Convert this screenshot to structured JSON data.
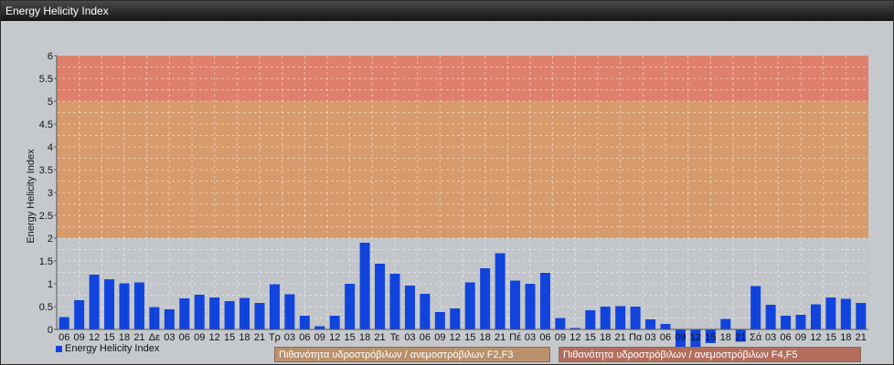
{
  "window": {
    "title": "Energy Helicity Index"
  },
  "legend": {
    "label": "Energy Helicity Index"
  },
  "bands": [
    {
      "label": "Πιθανότητα υδροστρόβιλων / ανεμοστρόβιλων F2,F3",
      "from": 2,
      "to": 5,
      "color": "#d79a6a"
    },
    {
      "label": "Πιθανότητα υδροστρόβιλων / ανεμοστρόβιλων F4,F5",
      "from": 5,
      "to": 6,
      "color": "#de806c"
    }
  ],
  "chart_data": {
    "type": "bar",
    "ylabel": "Energy Helicity Index",
    "ylim": [
      0,
      6
    ],
    "yticks": [
      "0",
      "0.5",
      "1",
      "1.5",
      "2",
      "2.5",
      "3",
      "3.5",
      "4",
      "4.5",
      "5",
      "5.5",
      "6"
    ],
    "grid": true,
    "legend_position": "bottom-left",
    "bar_color": "#1144dd",
    "categories": [
      "06",
      "09",
      "12",
      "15",
      "18",
      "21",
      "Δε",
      "03",
      "06",
      "09",
      "12",
      "15",
      "18",
      "21",
      "Τρ",
      "03",
      "06",
      "09",
      "12",
      "15",
      "18",
      "21",
      "Τε",
      "03",
      "06",
      "09",
      "12",
      "15",
      "18",
      "21",
      "Πέ",
      "03",
      "06",
      "09",
      "12",
      "15",
      "18",
      "21",
      "Πα",
      "03",
      "06",
      "09",
      "12",
      "15",
      "18",
      "21",
      "Σά",
      "03",
      "06",
      "09",
      "12",
      "15",
      "18",
      "21"
    ],
    "values": [
      0.27,
      0.64,
      1.2,
      1.1,
      1.01,
      1.03,
      0.49,
      0.44,
      0.68,
      0.76,
      0.7,
      0.62,
      0.69,
      0.58,
      0.99,
      0.77,
      0.3,
      0.07,
      0.3,
      1.0,
      1.9,
      1.44,
      1.22,
      0.96,
      0.78,
      0.38,
      0.46,
      1.03,
      1.34,
      1.67,
      1.07,
      1.0,
      1.24,
      0.25,
      0.03,
      0.42,
      0.5,
      0.51,
      0.5,
      0.22,
      0.12,
      -0.4,
      -0.45,
      -0.3,
      0.23,
      -0.27,
      0.95,
      0.54,
      0.3,
      0.32,
      0.55,
      0.7,
      0.67,
      0.58
    ]
  }
}
